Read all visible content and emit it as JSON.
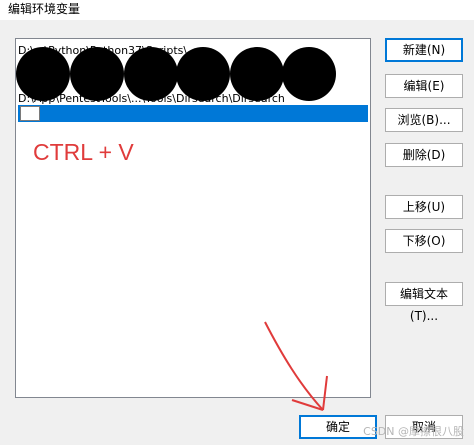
{
  "window": {
    "title": "编辑环境变量"
  },
  "list": {
    "rows": [
      "D:\\...\\Python\\Python37\\Scripts\\",
      "",
      "",
      "D:\\App\\PentestTools\\...\\Tools\\Dirsearch\\Dirsearch"
    ],
    "selected_row_value": ""
  },
  "annotation": {
    "text": "CTRL + V",
    "color": "#e03b3b"
  },
  "buttons": {
    "new": "新建(N)",
    "edit": "编辑(E)",
    "browse": "浏览(B)...",
    "delete": "删除(D)",
    "move_up": "上移(U)",
    "move_down": "下移(O)",
    "edit_text": "编辑文本(T)...",
    "ok": "确定",
    "cancel": "取消"
  },
  "watermark": "CSDN @摩擦很八股",
  "colors": {
    "selection": "#0078d7",
    "arrow": "#e03b3b"
  }
}
